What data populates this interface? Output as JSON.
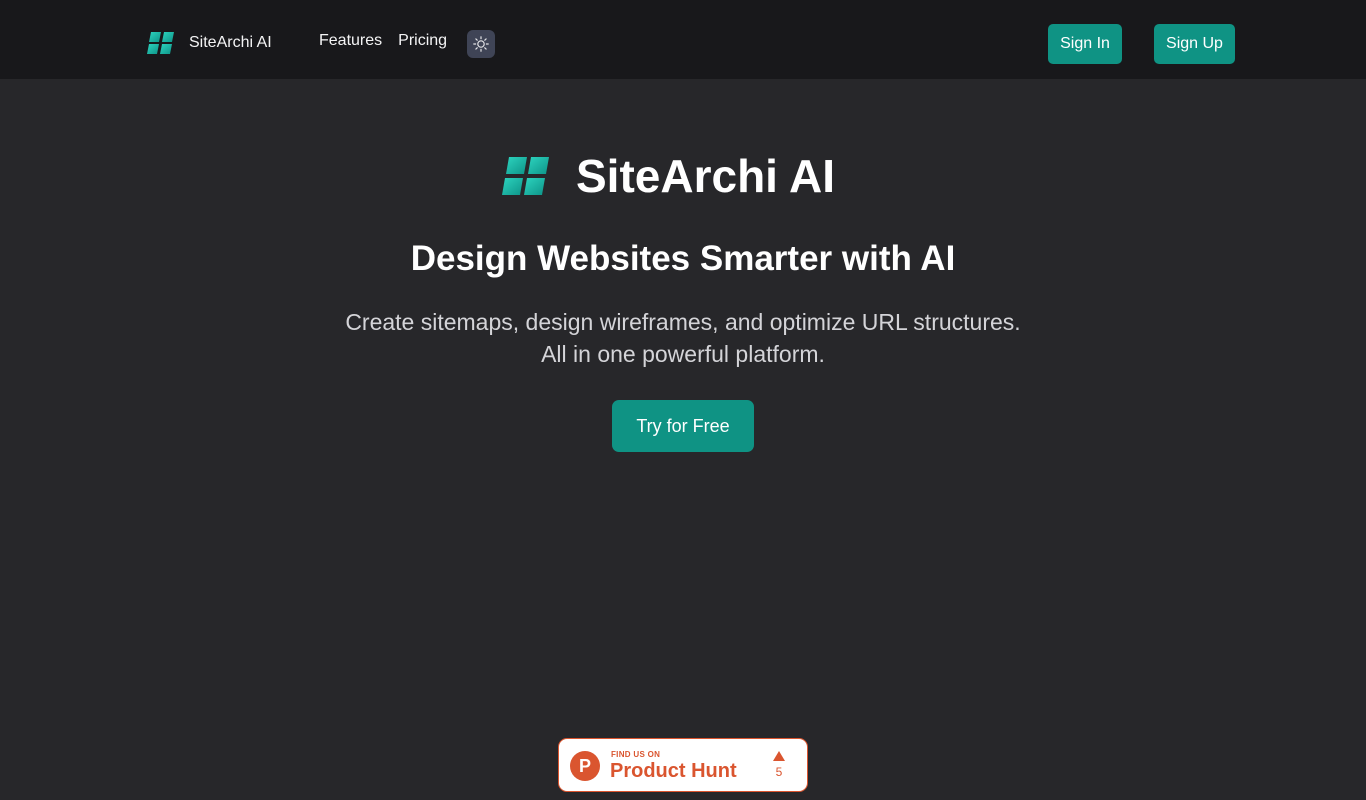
{
  "nav": {
    "brand_name": "SiteArchi AI",
    "logo_icon": "sitearchi-logo-icon",
    "links": [
      {
        "label": "Features"
      },
      {
        "label": "Pricing"
      }
    ],
    "theme_toggle_icon": "sun-icon",
    "signin_label": "Sign In",
    "signup_label": "Sign Up"
  },
  "hero": {
    "brand_name": "SiteArchi AI",
    "title": "Design Websites Smarter with AI",
    "subtitle_line1": "Create sitemaps, design wireframes, and optimize URL structures.",
    "subtitle_line2": "All in one powerful platform.",
    "cta_label": "Try for Free"
  },
  "product_hunt": {
    "kicker": "FIND US ON",
    "name": "Product Hunt",
    "logo_letter": "P",
    "upvote_count": "5"
  },
  "colors": {
    "page_bg": "#27272a",
    "navbar_bg": "#18181b",
    "accent": "#0f9384",
    "logo_gradient_start": "#2dd4bf",
    "logo_gradient_end": "#0d9488",
    "product_hunt": "#da552f"
  }
}
